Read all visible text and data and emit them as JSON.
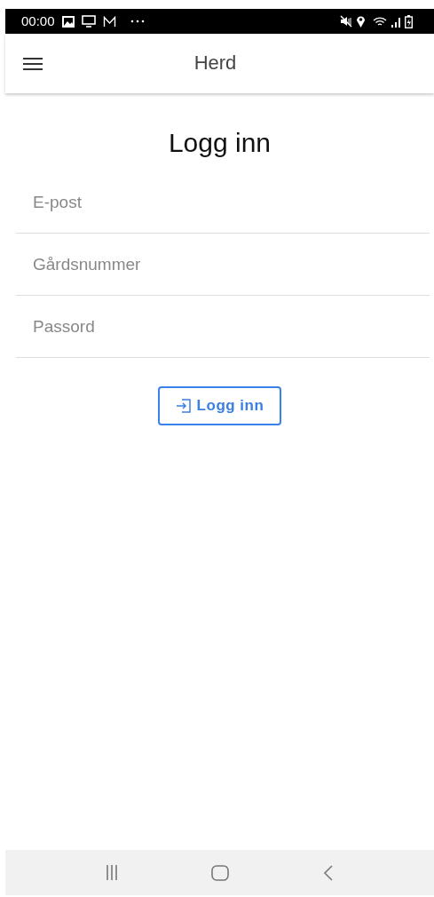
{
  "status_bar": {
    "time": "00:00"
  },
  "app_bar": {
    "title": "Herd"
  },
  "heading": "Logg inn",
  "fields": [
    {
      "placeholder": "E-post"
    },
    {
      "placeholder": "Gårdsnummer"
    },
    {
      "placeholder": "Passord"
    }
  ],
  "login_button": {
    "label": "Logg inn"
  }
}
